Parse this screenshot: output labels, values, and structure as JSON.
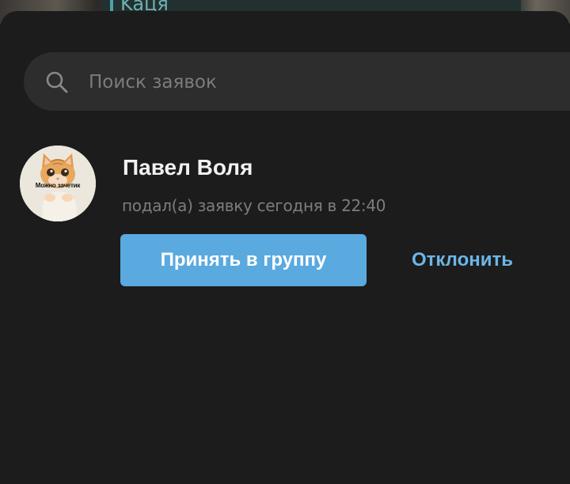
{
  "background_chat": {
    "name": "Kaця"
  },
  "search": {
    "placeholder": "Поиск заявок",
    "value": "",
    "icon": "search-icon"
  },
  "request": {
    "avatar_caption": "Можно зачетик",
    "name": "Павел Воля",
    "subtitle": "подал(а) заявку сегодня в 22:40",
    "accept_label": "Принять в группу",
    "decline_label": "Отклонить"
  },
  "colors": {
    "sheet": "#1c1c1c",
    "search_bg": "#2d2d2d",
    "accent": "#5aaadf",
    "link": "#6cb6e6"
  }
}
